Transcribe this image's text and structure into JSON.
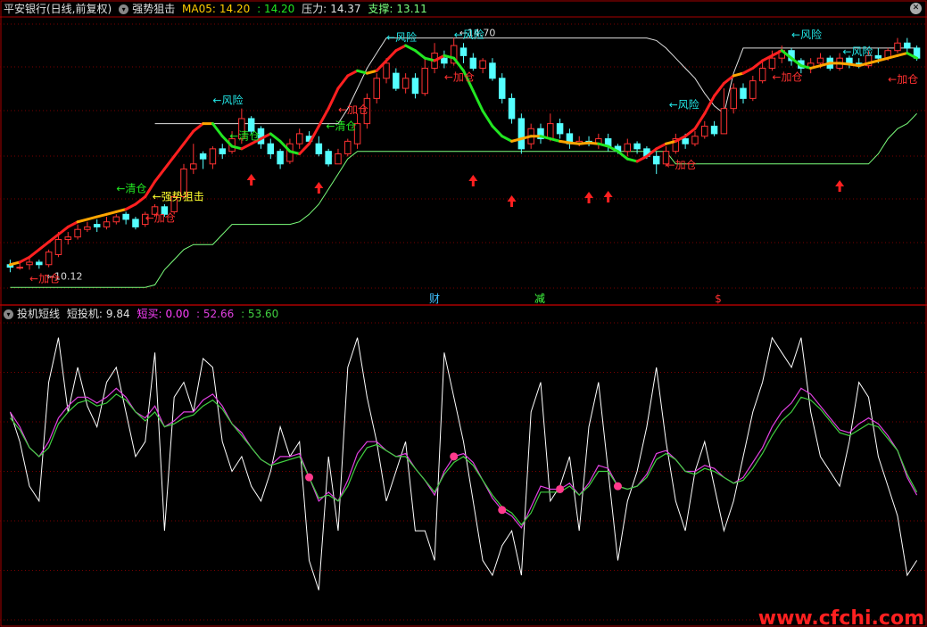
{
  "colors": {
    "up": "#ff3232",
    "down": "#54ffff",
    "ma_up": "#ff2020",
    "ma_mid": "#ffa500",
    "ma_down": "#22e622",
    "resistance": "#e0e0e0",
    "support": "#7cff7c",
    "risk_label": "#22e6e6",
    "add_label": "#ff3030",
    "clear_label": "#22e622",
    "signal_label": "#ffff30",
    "arrow": "#ff2020",
    "grid": "#7a0000",
    "frame": "#aa0000",
    "sub_white": "#ffffff",
    "sub_magenta": "#e040e0",
    "sub_green": "#40d040",
    "buy_dot": "#ff3a8c",
    "watermark": "#ff2020"
  },
  "main_header": {
    "stock": "平安银行(日线,前复权)",
    "indicator": "强势狙击",
    "ma_label": "MA05:",
    "ma_value": "14.20",
    "ma_value2": ": 14.20",
    "pressure_label": "压力:",
    "pressure_value": "14.37",
    "support_label": "支撑:",
    "support_value": "13.11"
  },
  "sub_header": {
    "indicator": "投机短线",
    "short_label": "短投机:",
    "short_value": "9.84",
    "buy_label": "短买:",
    "buy_value": "0.00",
    "v2": ": 52.66",
    "v3": ": 53.60"
  },
  "events": [
    "财",
    "减",
    "$"
  ],
  "watermark": "www.cfchi.com",
  "icons": [
    "dropdown-icon",
    "close-icon"
  ],
  "chart_data": {
    "type": "candlestick",
    "y_range": [
      9.7,
      15.1
    ],
    "high_mark": "14.70",
    "low_mark": "10.12",
    "ma5": [
      10.2,
      10.25,
      10.35,
      10.5,
      10.65,
      10.8,
      10.95,
      11.05,
      11.1,
      11.15,
      11.2,
      11.25,
      11.3,
      11.4,
      11.55,
      11.85,
      12.1,
      12.35,
      12.6,
      12.85,
      13.0,
      13.0,
      12.75,
      12.55,
      12.5,
      12.6,
      12.7,
      12.8,
      12.65,
      12.45,
      12.4,
      12.6,
      12.95,
      13.3,
      13.7,
      13.95,
      14.05,
      14.0,
      14.05,
      14.25,
      14.45,
      14.55,
      14.45,
      14.3,
      14.25,
      14.35,
      14.3,
      14.05,
      13.65,
      13.25,
      12.95,
      12.75,
      12.65,
      12.7,
      12.75,
      12.75,
      12.7,
      12.65,
      12.62,
      12.6,
      12.62,
      12.6,
      12.55,
      12.45,
      12.3,
      12.25,
      12.35,
      12.5,
      12.6,
      12.65,
      12.75,
      12.9,
      13.2,
      13.55,
      13.8,
      13.95,
      14.0,
      14.1,
      14.25,
      14.35,
      14.45,
      14.3,
      14.15,
      14.1,
      14.15,
      14.2,
      14.2,
      14.18,
      14.15,
      14.2,
      14.25,
      14.3,
      14.35,
      14.4,
      14.3
    ],
    "resistance_start": 15,
    "resistance": [
      13.0,
      13.0,
      13.0,
      13.0,
      13.0,
      13.0,
      13.0,
      13.0,
      13.0,
      13.0,
      13.0,
      13.0,
      13.0,
      13.0,
      13.0,
      13.0,
      13.0,
      13.0,
      13.0,
      13.0,
      13.3,
      13.7,
      14.1,
      14.4,
      14.7,
      14.7,
      14.7,
      14.7,
      14.7,
      14.7,
      14.7,
      14.7,
      14.7,
      14.7,
      14.7,
      14.7,
      14.7,
      14.7,
      14.7,
      14.7,
      14.7,
      14.7,
      14.7,
      14.7,
      14.7,
      14.7,
      14.7,
      14.7,
      14.7,
      14.7,
      14.7,
      14.7,
      14.65,
      14.5,
      14.3,
      14.1,
      13.9,
      13.6,
      13.35,
      13.2,
      14.0,
      14.5,
      14.5,
      14.5,
      14.5,
      14.5,
      14.5,
      14.5,
      14.5,
      14.5,
      14.5,
      14.5,
      14.5,
      14.5,
      14.5,
      14.5,
      14.5,
      14.5,
      14.5,
      14.5
    ],
    "support": [
      9.75,
      9.75,
      9.75,
      9.75,
      9.75,
      9.75,
      9.75,
      9.75,
      9.75,
      9.75,
      9.75,
      9.75,
      9.75,
      9.75,
      9.75,
      9.8,
      10.1,
      10.3,
      10.5,
      10.6,
      10.6,
      10.6,
      10.8,
      11.0,
      11.0,
      11.0,
      11.0,
      11.0,
      11.0,
      11.0,
      11.05,
      11.2,
      11.4,
      11.7,
      12.0,
      12.3,
      12.45,
      12.45,
      12.45,
      12.45,
      12.45,
      12.45,
      12.45,
      12.45,
      12.45,
      12.45,
      12.45,
      12.45,
      12.45,
      12.45,
      12.45,
      12.45,
      12.45,
      12.45,
      12.45,
      12.45,
      12.45,
      12.45,
      12.45,
      12.45,
      12.45,
      12.45,
      12.45,
      12.45,
      12.45,
      12.45,
      12.45,
      12.45,
      12.45,
      12.2,
      12.2,
      12.2,
      12.2,
      12.2,
      12.2,
      12.2,
      12.2,
      12.2,
      12.2,
      12.2,
      12.2,
      12.2,
      12.2,
      12.2,
      12.2,
      12.2,
      12.2,
      12.2,
      12.2,
      12.2,
      12.4,
      12.7,
      12.9,
      13.0,
      13.2
    ],
    "candles": [
      [
        10.2,
        10.15,
        10.3,
        10.05
      ],
      [
        10.15,
        10.15,
        10.25,
        10.1
      ],
      [
        10.2,
        10.25,
        10.35,
        10.1
      ],
      [
        10.25,
        10.2,
        10.3,
        10.12
      ],
      [
        10.2,
        10.45,
        10.5,
        10.15
      ],
      [
        10.4,
        10.7,
        10.85,
        10.35
      ],
      [
        10.7,
        10.75,
        10.85,
        10.6
      ],
      [
        10.75,
        10.9,
        11.0,
        10.7
      ],
      [
        10.9,
        10.95,
        11.05,
        10.85
      ],
      [
        11.0,
        10.95,
        11.1,
        10.85
      ],
      [
        10.95,
        11.05,
        11.15,
        10.9
      ],
      [
        11.05,
        11.15,
        11.2,
        11.0
      ],
      [
        11.2,
        11.1,
        11.25,
        11.0
      ],
      [
        11.1,
        10.95,
        11.15,
        10.9
      ],
      [
        11.0,
        11.2,
        11.25,
        10.95
      ],
      [
        11.2,
        11.35,
        11.4,
        11.15
      ],
      [
        11.35,
        11.2,
        11.4,
        11.15
      ],
      [
        11.25,
        11.55,
        11.6,
        11.2
      ],
      [
        11.55,
        12.1,
        12.2,
        11.5
      ],
      [
        12.1,
        12.2,
        12.6,
        12.0
      ],
      [
        12.4,
        12.3,
        12.45,
        12.1
      ],
      [
        12.2,
        12.5,
        12.55,
        12.1
      ],
      [
        12.5,
        12.4,
        12.6,
        12.3
      ],
      [
        12.45,
        12.7,
        12.85,
        12.4
      ],
      [
        12.7,
        13.1,
        13.3,
        12.6
      ],
      [
        13.1,
        12.85,
        13.15,
        12.8
      ],
      [
        12.9,
        12.6,
        12.95,
        12.5
      ],
      [
        12.6,
        12.4,
        12.7,
        12.3
      ],
      [
        12.45,
        12.2,
        12.5,
        12.1
      ],
      [
        12.25,
        12.6,
        12.7,
        12.2
      ],
      [
        12.6,
        12.8,
        12.9,
        12.5
      ],
      [
        12.75,
        12.65,
        12.85,
        12.6
      ],
      [
        12.6,
        12.4,
        12.75,
        12.35
      ],
      [
        12.45,
        12.2,
        12.5,
        12.15
      ],
      [
        12.2,
        12.4,
        12.5,
        12.2
      ],
      [
        12.4,
        12.65,
        12.7,
        12.35
      ],
      [
        12.6,
        13.0,
        13.2,
        12.5
      ],
      [
        13.0,
        13.5,
        13.6,
        12.9
      ],
      [
        13.5,
        13.9,
        14.0,
        13.4
      ],
      [
        13.9,
        14.2,
        14.3,
        13.8
      ],
      [
        14.0,
        13.7,
        14.1,
        13.65
      ],
      [
        13.7,
        13.9,
        14.0,
        13.6
      ],
      [
        13.9,
        13.6,
        14.0,
        13.5
      ],
      [
        13.6,
        14.1,
        14.3,
        13.55
      ],
      [
        14.1,
        14.4,
        14.6,
        14.0
      ],
      [
        14.3,
        14.2,
        14.45,
        14.1
      ],
      [
        14.2,
        14.55,
        14.7,
        14.15
      ],
      [
        14.5,
        14.35,
        14.6,
        14.2
      ],
      [
        14.3,
        14.1,
        14.4,
        14.05
      ],
      [
        14.1,
        14.25,
        14.3,
        14.0
      ],
      [
        14.2,
        13.9,
        14.3,
        13.85
      ],
      [
        13.9,
        13.5,
        14.0,
        13.4
      ],
      [
        13.5,
        13.1,
        13.6,
        13.0
      ],
      [
        13.1,
        12.5,
        13.2,
        12.4
      ],
      [
        12.6,
        12.9,
        13.0,
        12.5
      ],
      [
        12.9,
        12.7,
        13.0,
        12.6
      ],
      [
        12.7,
        13.0,
        13.2,
        12.65
      ],
      [
        13.0,
        12.8,
        13.1,
        12.7
      ],
      [
        12.8,
        12.6,
        12.9,
        12.5
      ],
      [
        12.6,
        12.65,
        12.75,
        12.55
      ],
      [
        12.65,
        12.6,
        12.75,
        12.55
      ],
      [
        12.6,
        12.7,
        12.8,
        12.5
      ],
      [
        12.7,
        12.55,
        12.8,
        12.45
      ],
      [
        12.55,
        12.45,
        12.6,
        12.4
      ],
      [
        12.45,
        12.6,
        12.7,
        12.35
      ],
      [
        12.6,
        12.5,
        12.65,
        12.4
      ],
      [
        12.5,
        12.35,
        12.55,
        12.3
      ],
      [
        12.35,
        12.2,
        12.45,
        12.0
      ],
      [
        12.2,
        12.45,
        12.55,
        12.15
      ],
      [
        12.45,
        12.7,
        12.8,
        12.4
      ],
      [
        12.7,
        12.6,
        12.8,
        12.5
      ],
      [
        12.6,
        12.75,
        12.85,
        12.55
      ],
      [
        12.75,
        12.95,
        13.05,
        12.7
      ],
      [
        12.95,
        12.8,
        13.05,
        12.75
      ],
      [
        12.8,
        13.3,
        13.7,
        12.8
      ],
      [
        13.3,
        13.7,
        13.8,
        13.2
      ],
      [
        13.7,
        13.5,
        13.8,
        13.4
      ],
      [
        13.5,
        13.85,
        13.95,
        13.45
      ],
      [
        13.85,
        14.1,
        14.25,
        13.8
      ],
      [
        14.1,
        14.3,
        14.45,
        14.05
      ],
      [
        14.3,
        14.45,
        14.55,
        14.2
      ],
      [
        14.45,
        14.25,
        14.5,
        14.15
      ],
      [
        14.25,
        14.1,
        14.3,
        14.0
      ],
      [
        14.1,
        14.2,
        14.3,
        14.0
      ],
      [
        14.2,
        14.3,
        14.4,
        14.1
      ],
      [
        14.3,
        14.1,
        14.35,
        14.05
      ],
      [
        14.1,
        14.3,
        14.4,
        14.05
      ],
      [
        14.3,
        14.2,
        14.35,
        14.1
      ],
      [
        14.2,
        14.15,
        14.3,
        14.1
      ],
      [
        14.15,
        14.35,
        14.45,
        14.1
      ],
      [
        14.35,
        14.3,
        14.5,
        14.2
      ],
      [
        14.3,
        14.45,
        14.5,
        14.25
      ],
      [
        14.45,
        14.6,
        14.7,
        14.4
      ],
      [
        14.6,
        14.5,
        14.7,
        14.4
      ],
      [
        14.5,
        14.3,
        14.55,
        14.25
      ]
    ],
    "signals": [
      {
        "idx": 2,
        "text": "加仓",
        "kind": "add",
        "where": "below"
      },
      {
        "idx": 14,
        "text": "加仓",
        "kind": "add",
        "where": "below"
      },
      {
        "idx": 14,
        "text": "强势狙击",
        "kind": "signal",
        "where": "right"
      },
      {
        "idx": 11,
        "text": "清仓",
        "kind": "clear",
        "where": "above"
      },
      {
        "idx": 21,
        "text": "风险",
        "kind": "risk",
        "where": "above"
      },
      {
        "idx": 22,
        "text": "清仓",
        "kind": "clear",
        "where": "right"
      },
      {
        "idx": 32,
        "text": "清仓",
        "kind": "clear",
        "where": "right"
      },
      {
        "idx": 34,
        "text": "加仓",
        "kind": "add",
        "where": "below"
      },
      {
        "idx": 39,
        "text": "风险",
        "kind": "risk",
        "where": "above"
      },
      {
        "idx": 45,
        "text": "加仓",
        "kind": "add",
        "where": "below"
      },
      {
        "idx": 46,
        "text": "风险",
        "kind": "risk",
        "where": "above"
      },
      {
        "idx": 68,
        "text": "加仓",
        "kind": "add",
        "where": "below"
      },
      {
        "idx": 72,
        "text": "风险",
        "kind": "risk",
        "where": "left"
      },
      {
        "idx": 79,
        "text": "加仓",
        "kind": "add",
        "where": "below"
      },
      {
        "idx": 81,
        "text": "风险",
        "kind": "risk",
        "where": "above"
      },
      {
        "idx": 90,
        "text": "风险",
        "kind": "risk",
        "where": "left"
      },
      {
        "idx": 91,
        "text": "加仓",
        "kind": "add",
        "where": "below"
      }
    ],
    "arrows": [
      25,
      32,
      48,
      52,
      60,
      62,
      86
    ],
    "sub": {
      "y_range": [
        0,
        100
      ],
      "white": [
        70,
        60,
        45,
        40,
        80,
        95,
        70,
        85,
        72,
        65,
        80,
        85,
        70,
        55,
        60,
        90,
        30,
        75,
        80,
        70,
        88,
        85,
        60,
        50,
        55,
        45,
        40,
        50,
        65,
        55,
        60,
        20,
        10,
        55,
        30,
        85,
        95,
        75,
        60,
        40,
        50,
        60,
        30,
        30,
        20,
        90,
        75,
        60,
        40,
        20,
        15,
        25,
        30,
        15,
        70,
        80,
        40,
        45,
        55,
        30,
        65,
        80,
        50,
        20,
        40,
        50,
        65,
        85,
        60,
        40,
        30,
        50,
        60,
        45,
        30,
        40,
        55,
        70,
        80,
        95,
        90,
        85,
        95,
        70,
        55,
        50,
        45,
        60,
        80,
        75,
        55,
        45,
        35,
        15,
        20
      ],
      "magenta": [
        70,
        65,
        58,
        55,
        60,
        68,
        72,
        75,
        75,
        73,
        75,
        78,
        75,
        70,
        68,
        72,
        65,
        67,
        70,
        70,
        74,
        76,
        72,
        66,
        63,
        58,
        54,
        52,
        55,
        55,
        56,
        48,
        40,
        43,
        40,
        47,
        56,
        60,
        60,
        57,
        55,
        56,
        51,
        47,
        42,
        50,
        55,
        56,
        53,
        47,
        41,
        37,
        35,
        31,
        38,
        45,
        44,
        44,
        46,
        42,
        46,
        52,
        51,
        45,
        44,
        45,
        49,
        56,
        57,
        54,
        50,
        50,
        52,
        51,
        48,
        46,
        48,
        53,
        58,
        65,
        70,
        73,
        78,
        76,
        72,
        68,
        64,
        63,
        66,
        68,
        66,
        62,
        57,
        48,
        42
      ],
      "green": [
        68,
        64,
        58,
        55,
        58,
        66,
        70,
        73,
        74,
        72,
        73,
        76,
        74,
        70,
        67,
        70,
        65,
        66,
        68,
        69,
        72,
        74,
        71,
        66,
        62,
        58,
        54,
        52,
        53,
        54,
        55,
        48,
        41,
        42,
        40,
        45,
        53,
        58,
        59,
        57,
        55,
        55,
        51,
        47,
        43,
        49,
        53,
        55,
        52,
        47,
        42,
        38,
        36,
        32,
        36,
        43,
        43,
        43,
        45,
        42,
        45,
        50,
        50,
        45,
        44,
        45,
        48,
        54,
        56,
        54,
        50,
        49,
        51,
        50,
        48,
        46,
        47,
        51,
        56,
        62,
        67,
        70,
        75,
        74,
        71,
        67,
        63,
        62,
        64,
        66,
        65,
        61,
        57,
        49,
        43
      ],
      "buy_dots": [
        31,
        46,
        51,
        57,
        63
      ]
    }
  }
}
